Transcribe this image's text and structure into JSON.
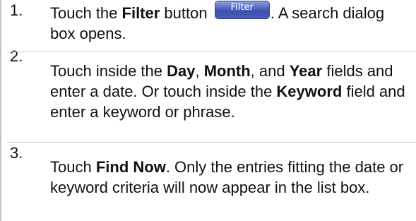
{
  "steps": [
    {
      "number": "1.",
      "parts": {
        "a": "Touch the ",
        "b": "Filter",
        "c": " button ",
        "button_label": "Filter",
        "d": ". A search dialog box opens."
      }
    },
    {
      "number": "2.",
      "parts": {
        "a": "Touch inside the ",
        "b": "Day",
        "c": ", ",
        "d": "Month",
        "e": ", and ",
        "f": "Year",
        "g": " fields and enter a date. Or touch inside the ",
        "h": "Keyword",
        "i": " field and enter a keyword or phrase."
      }
    },
    {
      "number": "3.",
      "parts": {
        "a": "Touch ",
        "b": "Find Now",
        "c": ". Only the entries fitting the date or keyword criteria will now appear in the list box."
      }
    }
  ]
}
